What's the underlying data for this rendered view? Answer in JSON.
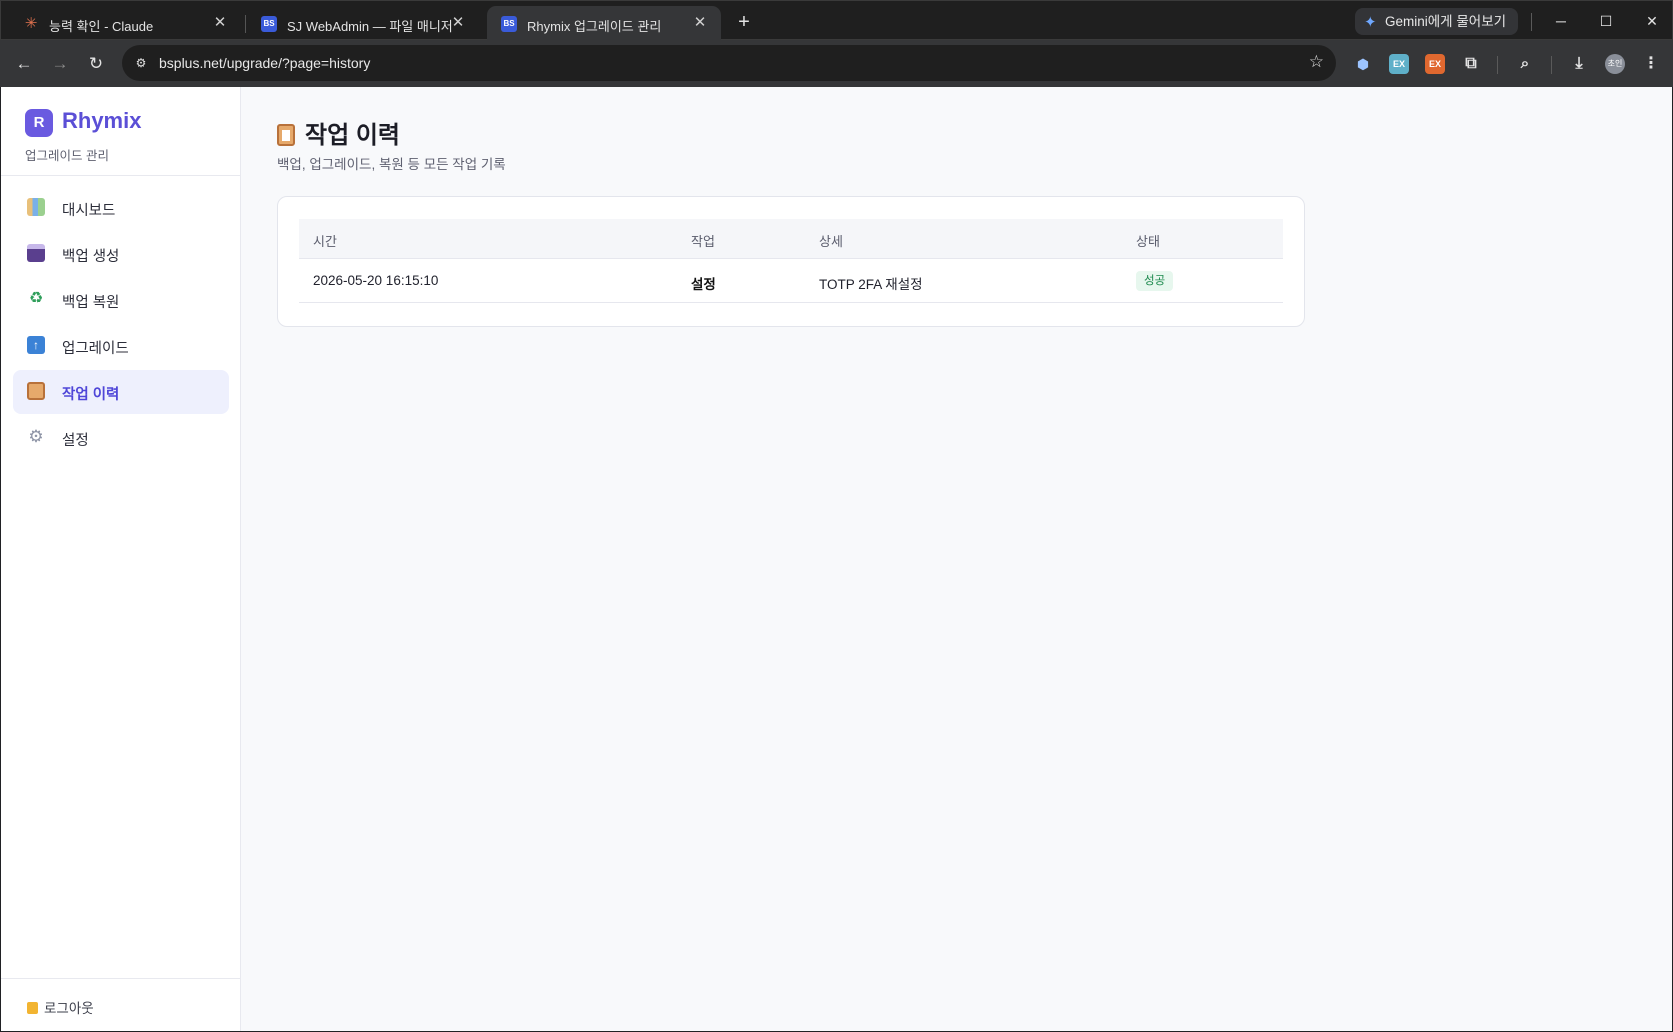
{
  "browser": {
    "tabs": [
      {
        "title": "능력 확인 - Claude",
        "favicon": "claude-icon"
      },
      {
        "title": "SJ WebAdmin — 파일 매니저",
        "favicon": "bs-icon"
      },
      {
        "title": "Rhymix 업그레이드 관리",
        "favicon": "bs-icon",
        "active": true
      }
    ],
    "gemini_label": "Gemini에게 물어보기",
    "url": "bsplus.net/upgrade/?page=history",
    "avatar_text": "초인",
    "extensions": [
      "EX",
      "EX"
    ]
  },
  "sidebar": {
    "logo_letter": "R",
    "brand_name": "Rhymix",
    "brand_sub": "업그레이드 관리",
    "items": [
      {
        "label": "대시보드",
        "icon": "bar-chart-icon"
      },
      {
        "label": "백업 생성",
        "icon": "floppy-disk-icon"
      },
      {
        "label": "백업 복원",
        "icon": "recycle-icon"
      },
      {
        "label": "업그레이드",
        "icon": "up-arrow-icon"
      },
      {
        "label": "작업 이력",
        "icon": "clipboard-icon",
        "active": true
      },
      {
        "label": "설정",
        "icon": "gear-icon"
      }
    ],
    "logout_label": "로그아웃"
  },
  "main": {
    "title": "작업 이력",
    "subtitle": "백업, 업그레이드, 복원 등 모든 작업 기록",
    "table": {
      "headers": [
        "시간",
        "작업",
        "상세",
        "상태"
      ],
      "rows": [
        {
          "time": "2026-05-20 16:15:10",
          "action": "설정",
          "detail": "TOTP 2FA 재설정",
          "status": "성공"
        }
      ]
    }
  },
  "colors": {
    "accent": "#5b4fd6",
    "active_nav_bg": "#eef0fd",
    "success_bg": "#e7f7ee",
    "success_text": "#1d8a4e"
  }
}
